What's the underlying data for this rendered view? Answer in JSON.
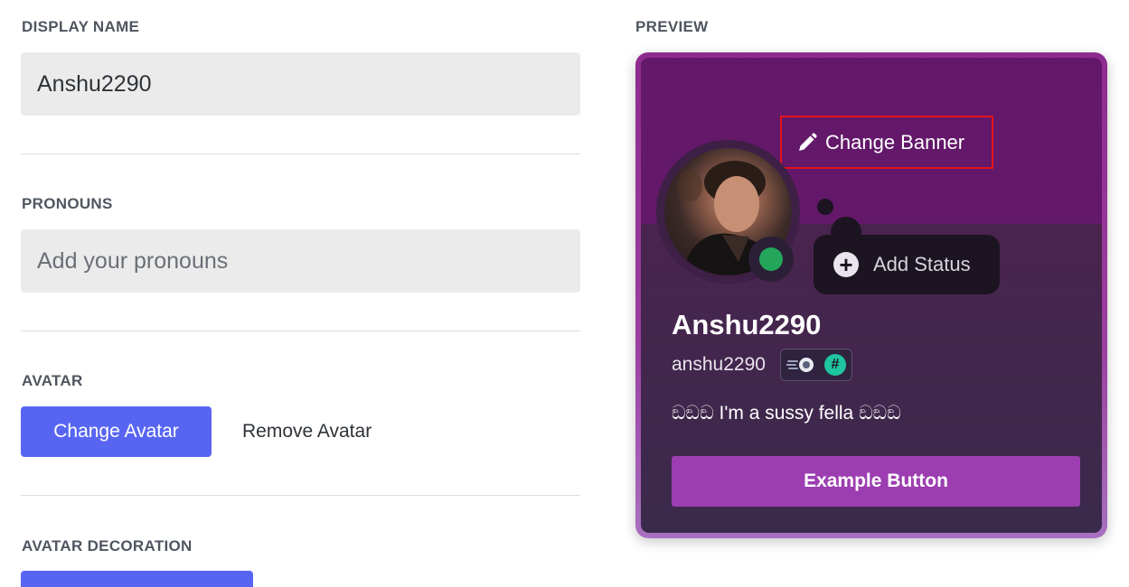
{
  "left": {
    "display_name": {
      "label": "DISPLAY NAME",
      "value": "Anshu2290"
    },
    "pronouns": {
      "label": "PRONOUNS",
      "placeholder": "Add your pronouns"
    },
    "avatar": {
      "label": "AVATAR",
      "change_label": "Change Avatar",
      "remove_label": "Remove Avatar"
    },
    "avatar_decoration": {
      "label": "AVATAR DECORATION"
    }
  },
  "preview": {
    "label": "PREVIEW",
    "change_banner_label": "Change Banner",
    "add_status_label": "Add Status",
    "display_name": "Anshu2290",
    "username": "anshu2290",
    "badge_hash": "#",
    "bio": "ඞඞඞ I'm a sussy fella ඞඞඞ",
    "example_button_label": "Example Button",
    "status": "online"
  },
  "icons": {
    "pencil": "pencil-icon",
    "plus": "plus-circle-icon",
    "nitro": "nitro-badge-icon",
    "hash": "hashtag-badge-icon"
  },
  "colors": {
    "blurple": "#5865f2",
    "online": "#23a55a",
    "accent_purple": "#9c3eb1",
    "highlight_red": "#e3141c"
  }
}
